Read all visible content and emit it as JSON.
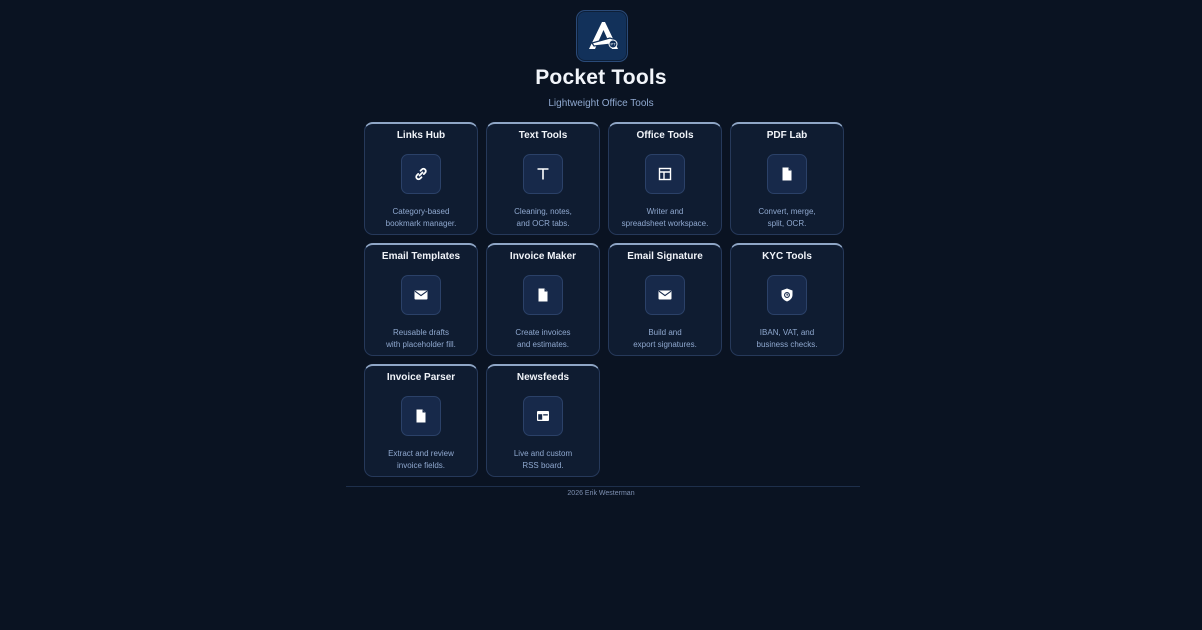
{
  "header": {
    "title": "Pocket Tools",
    "subtitle": "Lightweight Office Tools",
    "logo_icon": "pocket-knife-logo-icon"
  },
  "tools": [
    {
      "title": "Links Hub",
      "desc_line1": "Category-based",
      "desc_line2": "bookmark manager.",
      "icon": "link-icon"
    },
    {
      "title": "Text Tools",
      "desc_line1": "Cleaning, notes,",
      "desc_line2": "and OCR tabs.",
      "icon": "text-icon"
    },
    {
      "title": "Office Tools",
      "desc_line1": "Writer and",
      "desc_line2": "spreadsheet workspace.",
      "icon": "layout-icon"
    },
    {
      "title": "PDF Lab",
      "desc_line1": "Convert, merge,",
      "desc_line2": "split, OCR.",
      "icon": "document-icon"
    },
    {
      "title": "Email Templates",
      "desc_line1": "Reusable drafts",
      "desc_line2": "with placeholder fill.",
      "icon": "mail-icon"
    },
    {
      "title": "Invoice Maker",
      "desc_line1": "Create invoices",
      "desc_line2": "and estimates.",
      "icon": "document-icon"
    },
    {
      "title": "Email Signature",
      "desc_line1": "Build and",
      "desc_line2": "export signatures.",
      "icon": "mail-icon"
    },
    {
      "title": "KYC Tools",
      "desc_line1": "IBAN, VAT, and",
      "desc_line2": "business checks.",
      "icon": "shield-icon"
    },
    {
      "title": "Invoice Parser",
      "desc_line1": "Extract and review",
      "desc_line2": "invoice fields.",
      "icon": "document-icon"
    },
    {
      "title": "Newsfeeds",
      "desc_line1": "Live and custom",
      "desc_line2": "RSS board.",
      "icon": "feed-window-icon"
    }
  ],
  "footer": {
    "text": "2026 Erik Westerman"
  },
  "colors": {
    "background": "#0a1322",
    "card": "#0f1c31",
    "accent_text": "#8fa8cf"
  }
}
